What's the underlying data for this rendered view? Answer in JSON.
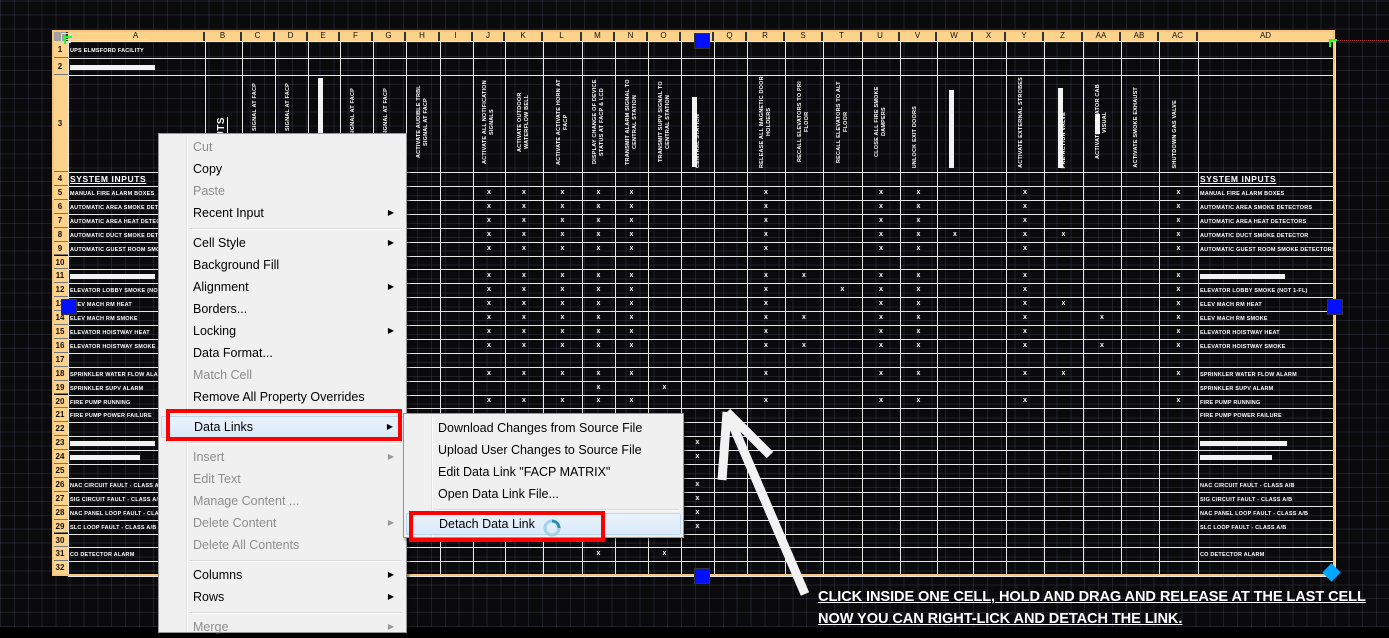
{
  "table": {
    "columns": [
      "A",
      "B",
      "C",
      "D",
      "E",
      "F",
      "G",
      "H",
      "I",
      "J",
      "K",
      "L",
      "M",
      "N",
      "O",
      "",
      "Q",
      "R",
      "S",
      "T",
      "U",
      "V",
      "W",
      "X",
      "Y",
      "Z",
      "AA",
      "AB",
      "AC",
      "AD"
    ],
    "rows": [
      "1",
      "2",
      "3",
      "4",
      "5",
      "6",
      "7",
      "8",
      "9",
      "10",
      "11",
      "12",
      "13",
      "14",
      "15",
      "16",
      "17",
      "18",
      "19",
      "20",
      "21",
      "22",
      "23",
      "24",
      "25",
      "26",
      "27",
      "28",
      "29",
      "30",
      "31",
      "32"
    ],
    "title": "UPS ELMSFORD FACILITY",
    "system_inputs_label": "SYSTEM INPUTS",
    "row3_headers": {
      "B": "OUTPUTS",
      "C": "IBLE ALARM SIGNAL AT FACP",
      "D": "IBLE ALARM SIGNAL AT FACP",
      "E": "FACP",
      "F": "IBLE SUPV SIGNAL AT FACP",
      "G": "IBLE TRBL SIGNAL AT FACP",
      "H": "ACTIVATE AUDIBLE TRBL SIGNAL AT FACP",
      "J": "ACTIVATE ALL NOTIFICATION SIGNALS",
      "K": "ACTIVATE OUTDOOR WATERFLOW BELL",
      "L": "ACTIVATE ACTIVATE HORN AT FACP",
      "M": "DISPLAY CHANGE OF DEVICE STATUS AT FACP & LCD",
      "N": "TRANSMIT ALARM SIGNAL TO CENTRAL STATION",
      "O": "TRANSMIT SUPV SIGNAL TO CENTRAL STATION",
      "P": "CENTRAL STATION",
      "R": "RELEASE ALL MAGNETIC DOOR HOLDERS",
      "S": "RECALL ELEVATORS TO PRI FLOOR",
      "T": "RECALL ELEVATORS TO ALT FLOOR",
      "U": "CLOSE ALL FIRE SMOKE DAMPERS",
      "V": "UNLOCK EXIT DOORS",
      "Y": "ACTIVATE EXTERNAL STROBES",
      "Z": "PRE-ACTION VALVE",
      "AA": "ACTIVATE ELEVATOR CAB VISUAL",
      "AB": "ACTIVATE SMOKE EXHAUST",
      "AC": "SHUTDOWN GAS VALVE"
    },
    "inputs": {
      "5": "MANUAL FIRE ALARM BOXES",
      "6": "AUTOMATIC AREA SMOKE DETECTORS",
      "7": "AUTOMATIC AREA HEAT DETECTORS",
      "8": "AUTOMATIC DUCT SMOKE DETECTOR",
      "9": "AUTOMATIC GUEST ROOM SMOKE DETECTORS",
      "12": "ELEVATOR LOBBY SMOKE (NOT 1-FL)",
      "13": "ELEV MACH RM HEAT",
      "14": "ELEV MACH RM SMOKE",
      "15": "ELEVATOR HOISTWAY HEAT",
      "16": "ELEVATOR HOISTWAY SMOKE",
      "18": "SPRINKLER WATER FLOW ALARM",
      "19": "SPRINKLER SUPV ALARM",
      "20": "FIRE PUMP RUNNING",
      "21": "FIRE PUMP POWER FAILURE",
      "26": "NAC CIRCUIT FAULT - CLASS A/B",
      "27": "SIG CIRCUIT FAULT - CLASS A/B",
      "28": "NAC PANEL LOOP FAULT - CLASS A/B",
      "29": "SLC LOOP FAULT - CLASS A/B",
      "31": "CO DETECTOR ALARM"
    },
    "mark_symbol": "x",
    "marks": {
      "5": [
        "J",
        "K",
        "L",
        "M",
        "N",
        "R",
        "U",
        "V",
        "Y",
        "AC"
      ],
      "6": [
        "J",
        "K",
        "L",
        "M",
        "N",
        "R",
        "U",
        "V",
        "Y",
        "AC"
      ],
      "7": [
        "J",
        "K",
        "L",
        "M",
        "N",
        "R",
        "U",
        "V",
        "Y",
        "AC"
      ],
      "8": [
        "J",
        "K",
        "L",
        "M",
        "N",
        "R",
        "U",
        "V",
        "W",
        "Y",
        "Z",
        "AC"
      ],
      "9": [
        "J",
        "K",
        "L",
        "M",
        "N",
        "R",
        "U",
        "V",
        "Y",
        "AC"
      ],
      "11": [
        "J",
        "K",
        "L",
        "M",
        "N",
        "R",
        "S",
        "U",
        "V",
        "Y",
        "AC"
      ],
      "12": [
        "J",
        "K",
        "L",
        "M",
        "N",
        "R",
        "T",
        "U",
        "V",
        "Y",
        "AC"
      ],
      "13": [
        "J",
        "K",
        "L",
        "M",
        "N",
        "R",
        "U",
        "V",
        "Y",
        "Z",
        "AC"
      ],
      "14": [
        "J",
        "K",
        "L",
        "M",
        "N",
        "R",
        "S",
        "U",
        "V",
        "Y",
        "AA",
        "AC"
      ],
      "15": [
        "J",
        "K",
        "L",
        "M",
        "N",
        "R",
        "U",
        "V",
        "Y",
        "AC"
      ],
      "16": [
        "J",
        "K",
        "L",
        "M",
        "N",
        "R",
        "S",
        "U",
        "V",
        "Y",
        "AA",
        "AC"
      ],
      "18": [
        "J",
        "K",
        "L",
        "M",
        "N",
        "R",
        "U",
        "V",
        "Y",
        "Z",
        "AC"
      ],
      "19": [
        "M",
        "O"
      ],
      "20": [
        "J",
        "K",
        "L",
        "M",
        "N",
        "R",
        "U",
        "V",
        "Y",
        "AC"
      ],
      "23": [
        "P"
      ],
      "24": [
        "P"
      ],
      "26": [
        "P"
      ],
      "27": [
        "P"
      ],
      "28": [
        "P"
      ],
      "29": [
        "P"
      ],
      "31": [
        "M",
        "O"
      ]
    }
  },
  "context_menu": {
    "items": [
      {
        "label": "Cut",
        "enabled": false,
        "submenu": false
      },
      {
        "label": "Copy",
        "enabled": true,
        "submenu": false
      },
      {
        "label": "Paste",
        "enabled": false,
        "submenu": false
      },
      {
        "label": "Recent Input",
        "enabled": true,
        "submenu": true
      },
      {
        "label": "Cell Style",
        "enabled": true,
        "submenu": true
      },
      {
        "label": "Background Fill",
        "enabled": true,
        "submenu": false
      },
      {
        "label": "Alignment",
        "enabled": true,
        "submenu": true
      },
      {
        "label": "Borders...",
        "enabled": true,
        "submenu": false
      },
      {
        "label": "Locking",
        "enabled": true,
        "submenu": true
      },
      {
        "label": "Data Format...",
        "enabled": true,
        "submenu": false
      },
      {
        "label": "Match Cell",
        "enabled": false,
        "submenu": false
      },
      {
        "label": "Remove All Property Overrides",
        "enabled": true,
        "submenu": false
      },
      {
        "label": "Data Links",
        "enabled": true,
        "submenu": true,
        "highlighted": true
      },
      {
        "label": "Insert",
        "enabled": false,
        "submenu": true
      },
      {
        "label": "Edit Text",
        "enabled": false,
        "submenu": false
      },
      {
        "label": "Manage Content ...",
        "enabled": false,
        "submenu": false
      },
      {
        "label": "Delete Content",
        "enabled": false,
        "submenu": true
      },
      {
        "label": "Delete All Contents",
        "enabled": false,
        "submenu": false
      },
      {
        "label": "Columns",
        "enabled": true,
        "submenu": true
      },
      {
        "label": "Rows",
        "enabled": true,
        "submenu": true
      },
      {
        "label": "Merge",
        "enabled": false,
        "submenu": true
      }
    ]
  },
  "data_links_submenu": {
    "items": [
      {
        "label": "Download Changes from Source File"
      },
      {
        "label": "Upload User Changes to Source File"
      },
      {
        "label": "Edit Data Link \"FACP MATRIX\""
      },
      {
        "label": "Open Data Link File..."
      },
      {
        "label": "Detach Data Link",
        "highlighted": true
      }
    ]
  },
  "annotation": {
    "line1": "CLICK INSIDE ONE CELL, HOLD AND DRAG AND RELEASE AT THE LAST CELL",
    "line2": "NOW YOU CAN RIGHT-LICK AND DETACH THE LINK."
  },
  "colors": {
    "header_fill": "#fdd28a",
    "grip": "#0010ff",
    "highlight_box": "#ff0000",
    "corner_grip": "#00a8ff"
  },
  "icons": [
    "busy-spinner-icon",
    "submenu-arrow-icon",
    "arrow-annotation"
  ]
}
